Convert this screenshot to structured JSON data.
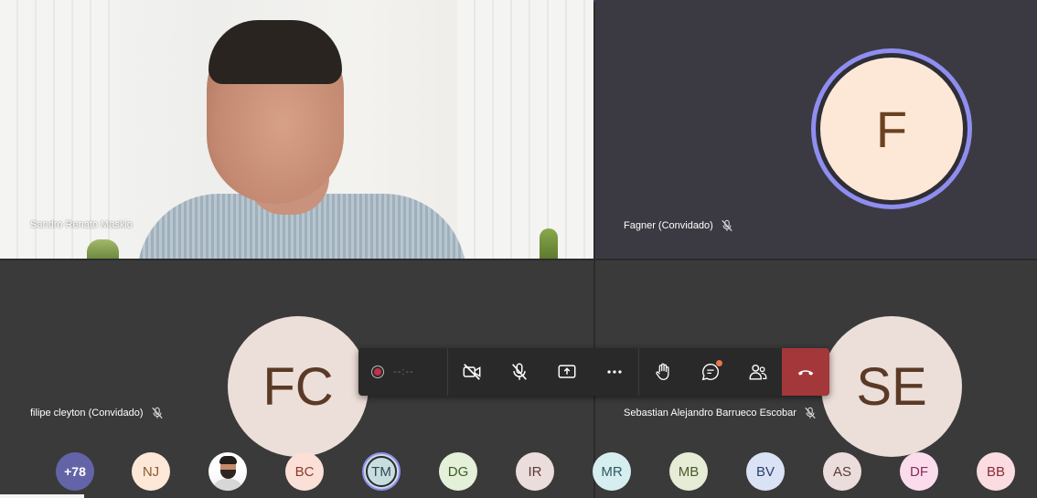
{
  "participants": {
    "sandro": {
      "name": "Sandro Renato Maskio"
    },
    "fagner": {
      "name": "Fagner (Convidado)",
      "initials": "F"
    },
    "filipe": {
      "name": "filipe cleyton (Convidado)",
      "initials": "FC"
    },
    "sebastian": {
      "name": "Sebastian Alejandro Barrueco Escobar",
      "initials": "SE"
    }
  },
  "controls": {
    "timer": "--:--",
    "buttons": [
      "camera-off",
      "mic-off",
      "share-screen",
      "more-options",
      "raise-hand",
      "chat",
      "participants",
      "hang-up"
    ]
  },
  "roster": {
    "overflow": "+78",
    "avatars": [
      {
        "initials": "NJ",
        "bg": "#fde8d8",
        "fg": "#8a5a2b"
      },
      {
        "initials": "",
        "bg": "#ffffff",
        "fg": "#000000"
      },
      {
        "initials": "BC",
        "bg": "#fbe0d8",
        "fg": "#8a3b2b"
      },
      {
        "initials": "TM",
        "bg": "#c8dde0",
        "fg": "#2f4a4f"
      },
      {
        "initials": "DG",
        "bg": "#e4f0d8",
        "fg": "#3d5a2b"
      },
      {
        "initials": "IR",
        "bg": "#eadddc",
        "fg": "#5a3a36"
      },
      {
        "initials": "MR",
        "bg": "#d7eef0",
        "fg": "#2d5a60"
      },
      {
        "initials": "MB",
        "bg": "#e6ecd5",
        "fg": "#4a5a2b"
      },
      {
        "initials": "BV",
        "bg": "#d9e3f5",
        "fg": "#2b3f6e"
      },
      {
        "initials": "AS",
        "bg": "#eadddc",
        "fg": "#5a3a36"
      },
      {
        "initials": "DF",
        "bg": "#fbdcec",
        "fg": "#8a2b5a"
      },
      {
        "initials": "BB",
        "bg": "#fbdce0",
        "fg": "#8a2b3a"
      }
    ]
  },
  "colors": {
    "accent": "#8f8ef0",
    "hangup": "#a4373a",
    "overflow": "#6264a7"
  }
}
